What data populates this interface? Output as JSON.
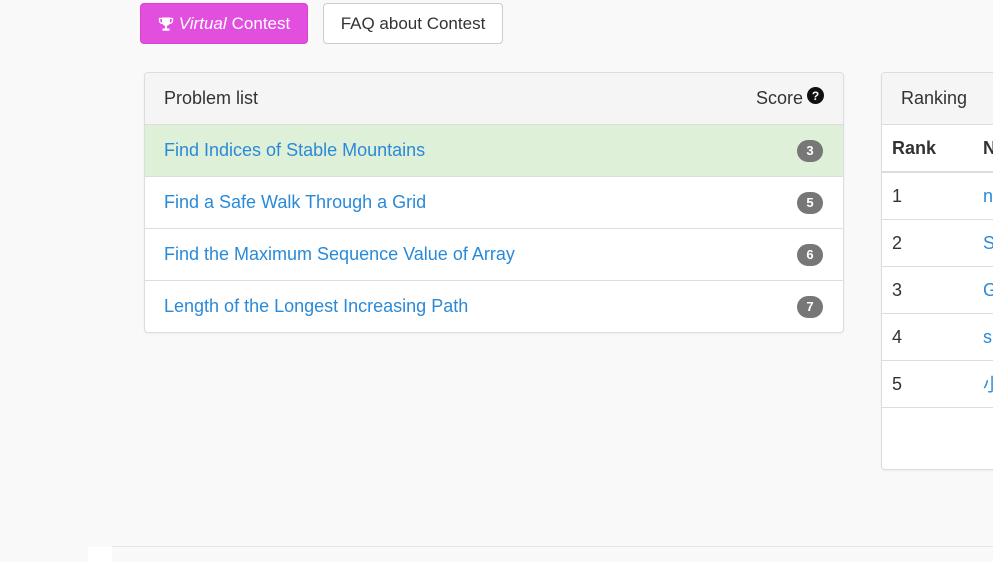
{
  "buttons": {
    "virtual_prefix": "Virtual",
    "virtual_suffix": "Contest",
    "faq": "FAQ about Contest"
  },
  "problem_panel": {
    "title": "Problem list",
    "score_label": "Score",
    "problems": [
      {
        "title": "Find Indices of Stable Mountains",
        "score": "3",
        "solved": true
      },
      {
        "title": "Find a Safe Walk Through a Grid",
        "score": "5",
        "solved": false
      },
      {
        "title": "Find the Maximum Sequence Value of Array",
        "score": "6",
        "solved": false
      },
      {
        "title": "Length of the Longest Increasing Path",
        "score": "7",
        "solved": false
      }
    ]
  },
  "ranking_panel": {
    "title": "Ranking",
    "headers": {
      "rank": "Rank",
      "name": "N"
    },
    "rows": [
      {
        "rank": "1",
        "name": "n"
      },
      {
        "rank": "2",
        "name": "S"
      },
      {
        "rank": "3",
        "name": "G"
      },
      {
        "rank": "4",
        "name": "s"
      },
      {
        "rank": "5",
        "name": "小"
      }
    ]
  },
  "colors": {
    "virtual_button": "#e24fdf",
    "link": "#2a8ad8",
    "solved_row": "#dff0d8",
    "badge": "#777777"
  },
  "icons": [
    "trophy-icon",
    "question-circle-icon"
  ]
}
